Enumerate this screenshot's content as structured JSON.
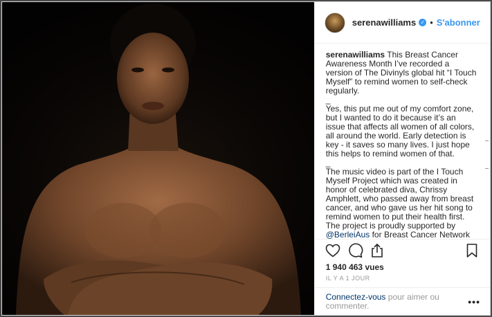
{
  "post": {
    "username": "serenawilliams",
    "follow_label": "S'abonner",
    "verified_icon": "verified-badge-icon",
    "separator": "•"
  },
  "caption": {
    "username": "serenawilliams",
    "para1": "This Breast Cancer Awareness Month I’ve recorded a version of The Divinyls global hit “I Touch Myself” to remind women to self-check regularly.",
    "sep1": "_",
    "para2": "Yes, this put me out of my comfort zone, but I wanted to do it because it’s an issue that affects all women of all colors, all around the world. Early detection is key - it saves so many lives. I just hope this helps to remind women of that.",
    "sep2": "_",
    "para3_before": "The music video is part of the I Touch Myself Project which was created in honor of celebrated diva, Chrissy Amphlett, who passed away from breast cancer, and who gave us her hit song to remind women to put their health first. The project is proudly supported by ",
    "mention": "@BerleiAus",
    "para3_after": " for Breast Cancer Network"
  },
  "actions": {
    "like_icon": "heart-icon",
    "comment_icon": "comment-icon",
    "share_icon": "share-icon",
    "save_icon": "bookmark-icon"
  },
  "stats": {
    "views": "1 940 463 vues",
    "time": "IL Y A 1 JOUR"
  },
  "comment": {
    "login_label": "Connectez-vous",
    "rest_label": " pour aimer ou commenter.",
    "more_label": "•••"
  },
  "colors": {
    "accent": "#3897f0",
    "link": "#003569",
    "muted": "#999999",
    "text": "#262626"
  }
}
